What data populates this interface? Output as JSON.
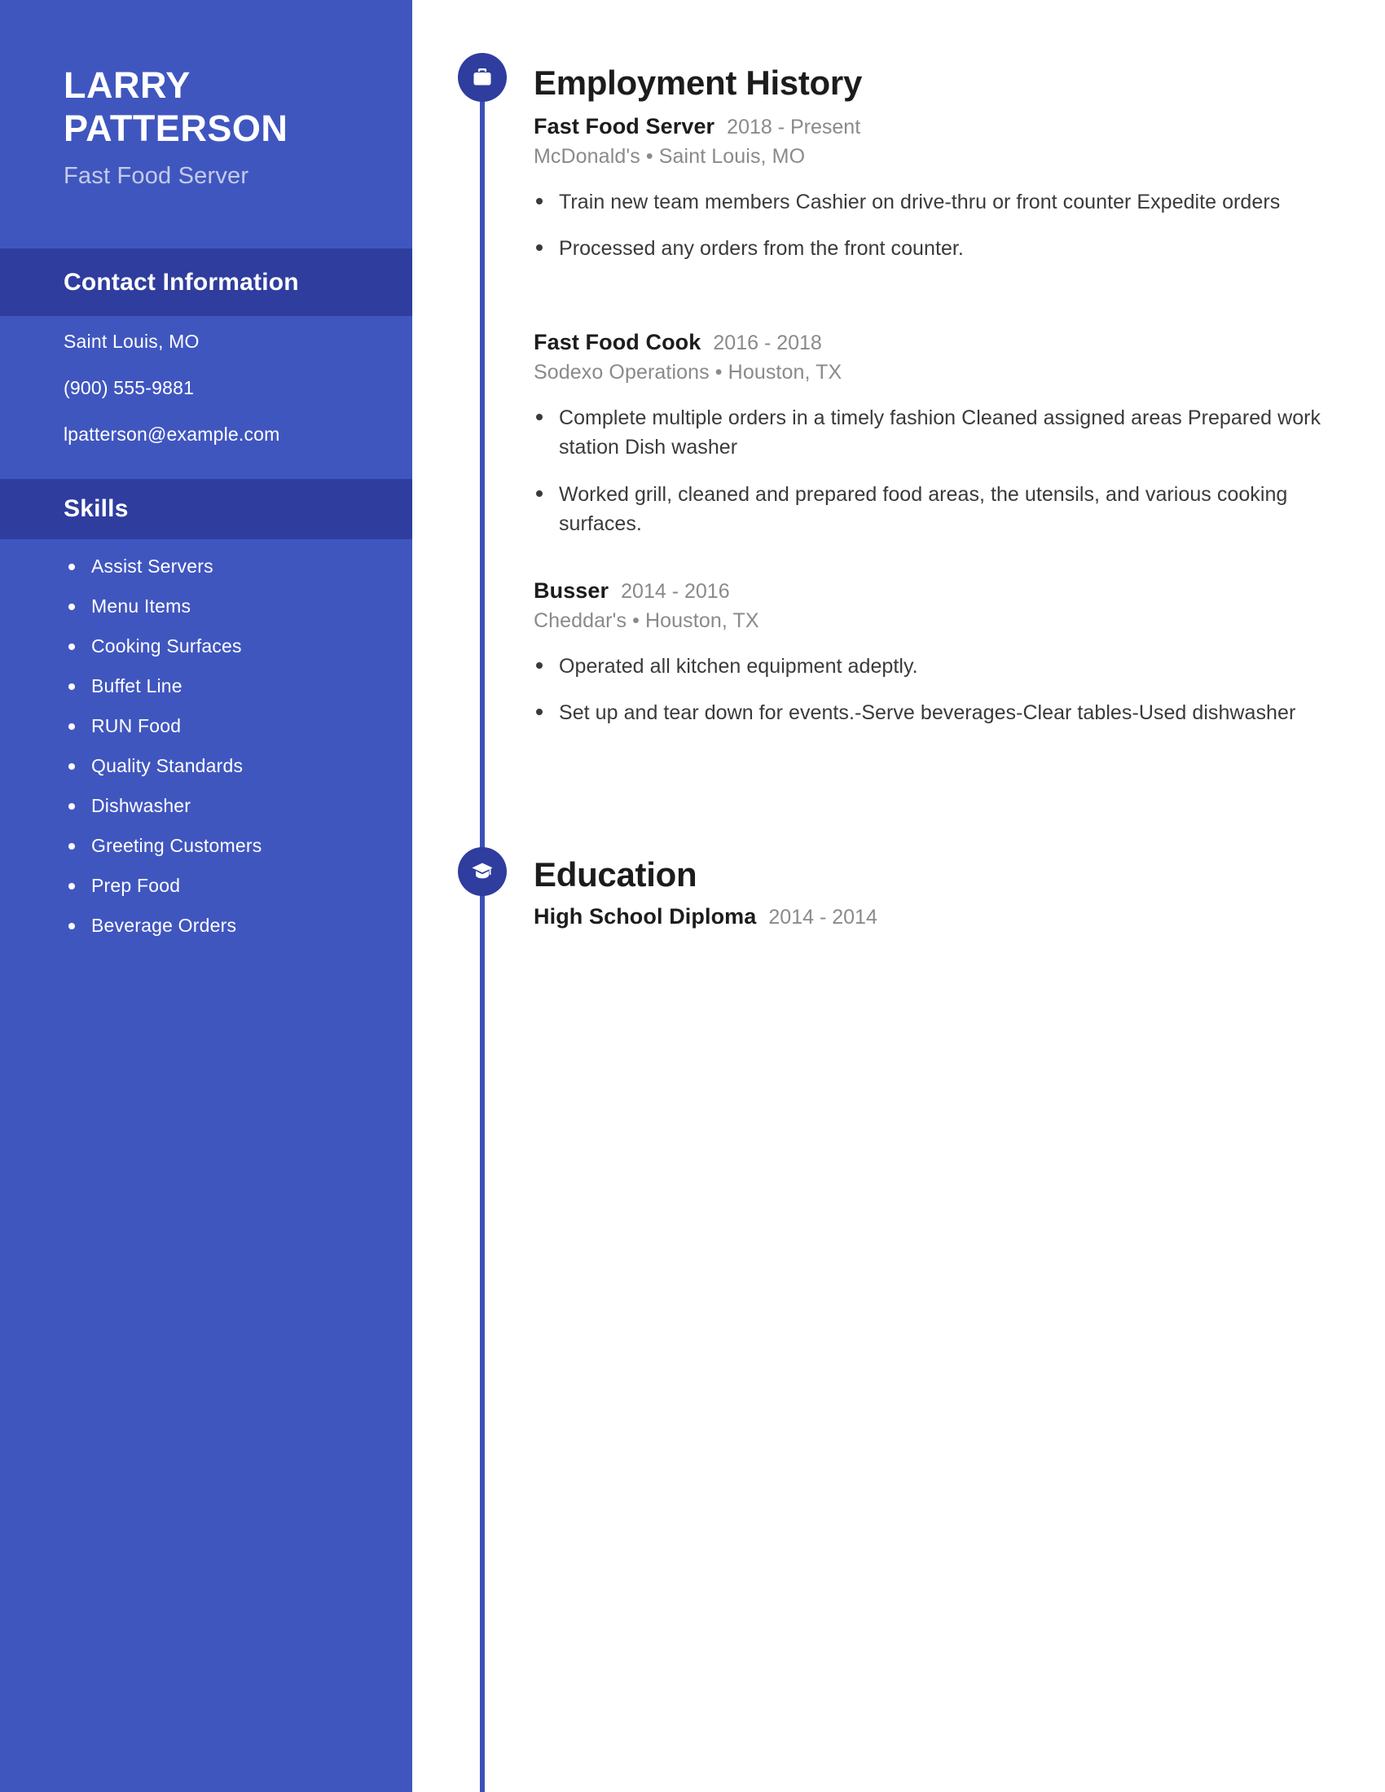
{
  "theme": {
    "sidebar_bg": "#4056bf",
    "band_bg": "#2e3d9e",
    "accent": "#2e3d9e",
    "timeline": "#3b50b5",
    "page_bg": "#ffffff",
    "muted_text": "#8a8a8a",
    "body_text": "#3a3a3a"
  },
  "sidebar": {
    "name_line1": "LARRY",
    "name_line2": "PATTERSON",
    "job_title": "Fast Food Server",
    "contact": {
      "heading": "Contact Information",
      "lines": [
        "Saint Louis, MO",
        "(900) 555-9881",
        "lpatterson@example.com"
      ]
    },
    "skills": {
      "heading": "Skills",
      "items": [
        "Assist Servers",
        "Menu Items",
        "Cooking Surfaces",
        "Buffet Line",
        "RUN Food",
        "Quality Standards",
        "Dishwasher",
        "Greeting Customers",
        "Prep Food",
        "Beverage Orders"
      ]
    }
  },
  "main": {
    "employment": {
      "heading": "Employment History",
      "icon": "briefcase-icon",
      "entries": [
        {
          "role": "Fast Food Server",
          "dates": "2018 - Present",
          "meta": "McDonald's • Saint Louis, MO",
          "bullets": [
            "Train new team members Cashier on drive-thru or front counter Expedite orders",
            "Processed any orders from the front counter."
          ]
        },
        {
          "role": "Fast Food Cook",
          "dates": "2016 - 2018",
          "meta": "Sodexo Operations • Houston, TX",
          "bullets": [
            "Complete multiple orders in a timely fashion Cleaned assigned areas Prepared work station Dish washer",
            "Worked grill, cleaned and prepared food areas, the utensils, and various cooking surfaces."
          ]
        },
        {
          "role": "Busser",
          "dates": "2014 - 2016",
          "meta": "Cheddar's • Houston, TX",
          "bullets": [
            "Operated all kitchen equipment adeptly.",
            "Set up and tear down for events.-Serve beverages-Clear tables-Used dishwasher"
          ]
        }
      ]
    },
    "education": {
      "heading": "Education",
      "icon": "graduation-cap-icon",
      "entries": [
        {
          "role": "High School Diploma",
          "dates": "2014 - 2014",
          "meta": "",
          "bullets": []
        }
      ]
    }
  }
}
